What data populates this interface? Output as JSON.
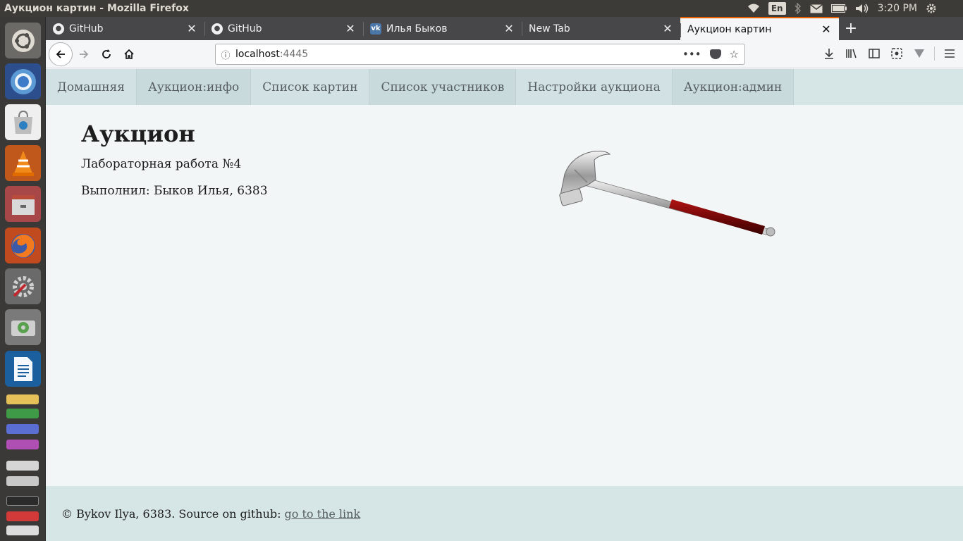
{
  "window": {
    "title": "Аукцион картин - Mozilla Firefox"
  },
  "system_tray": {
    "lang": "En",
    "clock": "3:20 PM",
    "icons": [
      "wifi-icon",
      "bluetooth-icon",
      "mail-icon",
      "battery-icon",
      "volume-icon",
      "settings-gear-icon"
    ]
  },
  "launcher": {
    "items": [
      "ubuntu-dash-icon",
      "chromium-icon",
      "software-center-icon",
      "vlc-icon",
      "files-icon",
      "firefox-icon",
      "system-settings-icon",
      "disks-icon",
      "libreoffice-writer-icon"
    ]
  },
  "tabs": [
    {
      "label": "GitHub",
      "icon": "github-icon",
      "active": false
    },
    {
      "label": "GitHub",
      "icon": "github-icon",
      "active": false
    },
    {
      "label": "Илья Быков",
      "icon": "vk-icon",
      "active": false
    },
    {
      "label": "New Tab",
      "icon": "",
      "active": false
    },
    {
      "label": "Аукцион картин",
      "icon": "",
      "active": true
    }
  ],
  "urlbar": {
    "host": "localhost",
    "port": ":4445"
  },
  "site": {
    "nav": [
      "Домашняя",
      "Аукцион:инфо",
      "Список картин",
      "Список участников",
      "Настройки аукциона",
      "Аукцион:админ"
    ],
    "heading": "Аукцион",
    "line1": "Лабораторная работа №4",
    "line2": "Выполнил: Быков Илья, 6383",
    "footer_text": "© Bykov Ilya, 6383. Source on github:",
    "footer_link": "go to the link"
  }
}
